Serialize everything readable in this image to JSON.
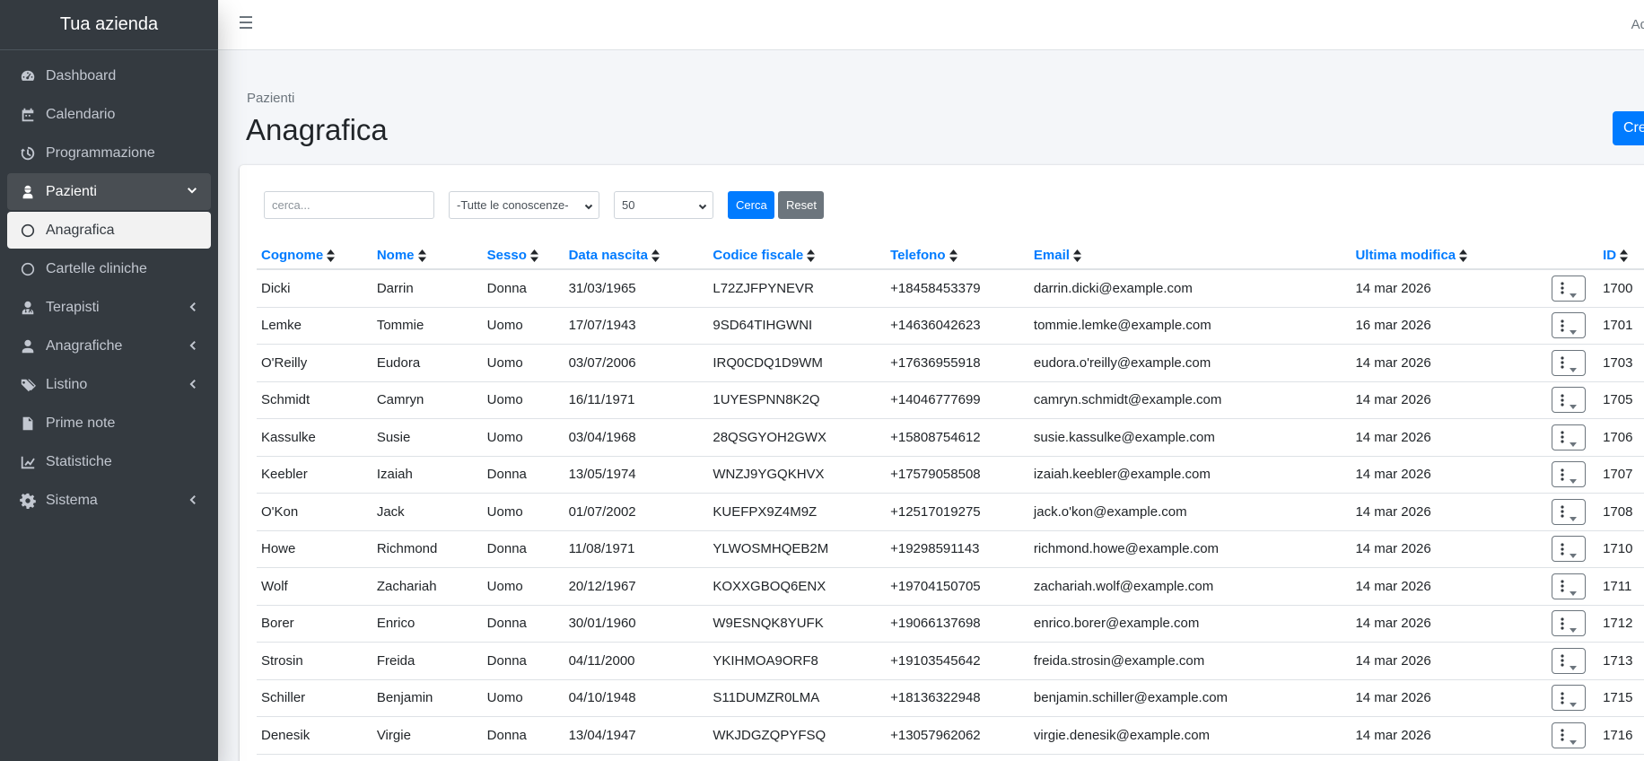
{
  "brand": "Tua azienda",
  "topbar": {
    "right_text": "Ad"
  },
  "sidebar": {
    "items": [
      {
        "label": "Dashboard",
        "icon": "tachometer-icon"
      },
      {
        "label": "Calendario",
        "icon": "calendar-icon"
      },
      {
        "label": "Programmazione",
        "icon": "history-icon"
      },
      {
        "label": "Pazienti",
        "icon": "user-injured-icon",
        "expanded": true
      },
      {
        "label": "Anagrafica",
        "icon": "circle-icon",
        "active": true
      },
      {
        "label": "Cartelle cliniche",
        "icon": "circle-icon"
      },
      {
        "label": "Terapisti",
        "icon": "user-md-icon",
        "submenu": true
      },
      {
        "label": "Anagrafiche",
        "icon": "address-book-icon",
        "submenu": true
      },
      {
        "label": "Listino",
        "icon": "tags-icon",
        "submenu": true
      },
      {
        "label": "Prime note",
        "icon": "file-icon"
      },
      {
        "label": "Statistiche",
        "icon": "chart-line-icon"
      },
      {
        "label": "Sistema",
        "icon": "cog-icon",
        "submenu": true
      }
    ]
  },
  "header": {
    "breadcrumb": "Pazienti",
    "title": "Anagrafica",
    "create_label": "Crea"
  },
  "filters": {
    "search_placeholder": "cerca...",
    "conoscenze_selected": "-Tutte le conoscenze-",
    "per_page_selected": "50",
    "search_button": "Cerca",
    "reset_button": "Reset"
  },
  "table": {
    "columns": [
      "Cognome",
      "Nome",
      "Sesso",
      "Data nascita",
      "Codice fiscale",
      "Telefono",
      "Email",
      "Ultima modifica",
      "",
      "ID"
    ],
    "rows": [
      [
        "Dicki",
        "Darrin",
        "Donna",
        "31/03/1965",
        "L72ZJFPYNEVR",
        "+18458453379",
        "darrin.dicki@example.com",
        "14 mar 2026",
        "1700"
      ],
      [
        "Lemke",
        "Tommie",
        "Uomo",
        "17/07/1943",
        "9SD64TIHGWNI",
        "+14636042623",
        "tommie.lemke@example.com",
        "16 mar 2026",
        "1701"
      ],
      [
        "O'Reilly",
        "Eudora",
        "Uomo",
        "03/07/2006",
        "IRQ0CDQ1D9WM",
        "+17636955918",
        "eudora.o'reilly@example.com",
        "14 mar 2026",
        "1703"
      ],
      [
        "Schmidt",
        "Camryn",
        "Uomo",
        "16/11/1971",
        "1UYESPNN8K2Q",
        "+14046777699",
        "camryn.schmidt@example.com",
        "14 mar 2026",
        "1705"
      ],
      [
        "Kassulke",
        "Susie",
        "Uomo",
        "03/04/1968",
        "28QSGYOH2GWX",
        "+15808754612",
        "susie.kassulke@example.com",
        "14 mar 2026",
        "1706"
      ],
      [
        "Keebler",
        "Izaiah",
        "Donna",
        "13/05/1974",
        "WNZJ9YGQKHVX",
        "+17579058508",
        "izaiah.keebler@example.com",
        "14 mar 2026",
        "1707"
      ],
      [
        "O'Kon",
        "Jack",
        "Uomo",
        "01/07/2002",
        "KUEFPX9Z4M9Z",
        "+12517019275",
        "jack.o'kon@example.com",
        "14 mar 2026",
        "1708"
      ],
      [
        "Howe",
        "Richmond",
        "Donna",
        "11/08/1971",
        "YLWOSMHQEB2M",
        "+19298591143",
        "richmond.howe@example.com",
        "14 mar 2026",
        "1710"
      ],
      [
        "Wolf",
        "Zachariah",
        "Uomo",
        "20/12/1967",
        "KOXXGBOQ6ENX",
        "+19704150705",
        "zachariah.wolf@example.com",
        "14 mar 2026",
        "1711"
      ],
      [
        "Borer",
        "Enrico",
        "Donna",
        "30/01/1960",
        "W9ESNQK8YUFK",
        "+19066137698",
        "enrico.borer@example.com",
        "14 mar 2026",
        "1712"
      ],
      [
        "Strosin",
        "Freida",
        "Donna",
        "04/11/2000",
        "YKIHMOA9ORF8",
        "+19103545642",
        "freida.strosin@example.com",
        "14 mar 2026",
        "1713"
      ],
      [
        "Schiller",
        "Benjamin",
        "Uomo",
        "04/10/1948",
        "S11DUMZR0LMA",
        "+18136322948",
        "benjamin.schiller@example.com",
        "14 mar 2026",
        "1715"
      ],
      [
        "Denesik",
        "Virgie",
        "Donna",
        "13/04/1947",
        "WKJDGZQPYFSQ",
        "+13057962062",
        "virgie.denesik@example.com",
        "14 mar 2026",
        "1716"
      ]
    ]
  },
  "colors": {
    "sidebar_bg": "#343a40",
    "primary": "#007bff",
    "secondary": "#6c757d"
  }
}
